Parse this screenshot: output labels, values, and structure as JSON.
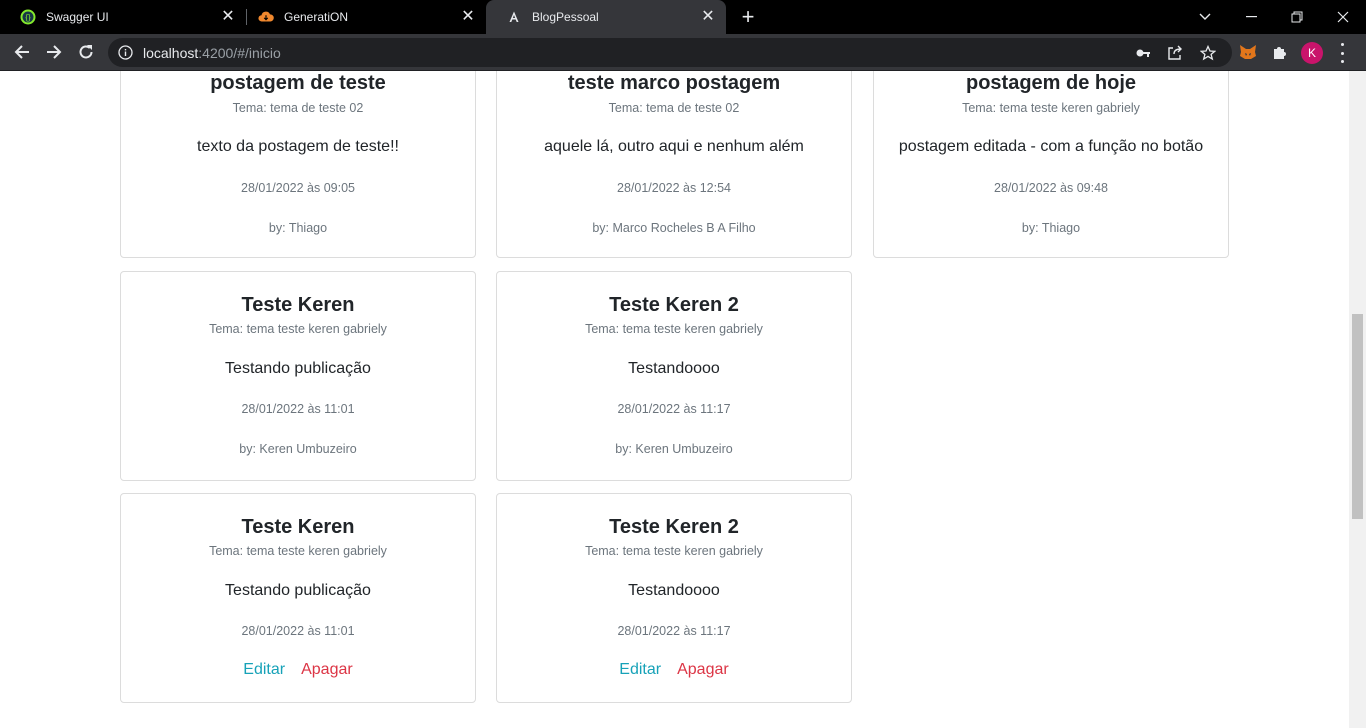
{
  "browser": {
    "tabs": [
      {
        "title": "Swagger UI",
        "icon": "swagger-icon",
        "active": false
      },
      {
        "title": "GeneratiON",
        "icon": "cloud-icon",
        "active": false
      },
      {
        "title": "BlogPessoal",
        "icon": "angular-icon",
        "active": true
      }
    ],
    "url_host": "localhost",
    "url_rest": ":4200/#/inicio",
    "profile_initial": "K",
    "colors": {
      "tabstrip": "#000000",
      "toolbar": "#35363a",
      "omnibox": "#202124",
      "profile": "#c9146b"
    }
  },
  "posts": [
    {
      "title": "postagem de teste",
      "tema": "Tema: tema de teste 02",
      "texto": "texto da postagem de teste!!",
      "data": "28/01/2022 às 09:05",
      "autor": "by: Thiago"
    },
    {
      "title": "teste marco postagem",
      "tema": "Tema: tema de teste 02",
      "texto": "aquele lá, outro aqui e nenhum além",
      "data": "28/01/2022 às 12:54",
      "autor": "by: Marco Rocheles B A Filho"
    },
    {
      "title": "postagem de hoje",
      "tema": "Tema: tema teste keren gabriely",
      "texto": "postagem editada - com a função no botão",
      "data": "28/01/2022 às 09:48",
      "autor": "by: Thiago"
    },
    {
      "title": "Teste Keren",
      "tema": "Tema: tema teste keren gabriely",
      "texto": "Testando publicação",
      "data": "28/01/2022 às 11:01",
      "autor": "by: Keren Umbuzeiro"
    },
    {
      "title": "Teste Keren 2",
      "tema": "Tema: tema teste keren gabriely",
      "texto": "Testandoooo",
      "data": "28/01/2022 às 11:17",
      "autor": "by: Keren Umbuzeiro"
    },
    {
      "title": "Teste Keren",
      "tema": "Tema: tema teste keren gabriely",
      "texto": "Testando publicação",
      "data": "28/01/2022 às 11:01",
      "edit_label": "Editar",
      "delete_label": "Apagar"
    },
    {
      "title": "Teste Keren 2",
      "tema": "Tema: tema teste keren gabriely",
      "texto": "Testandoooo",
      "data": "28/01/2022 às 11:17",
      "edit_label": "Editar",
      "delete_label": "Apagar"
    }
  ],
  "colors": {
    "edit": "#17a2b8",
    "delete": "#dc3545",
    "muted": "#6c757d",
    "text": "#212529"
  }
}
